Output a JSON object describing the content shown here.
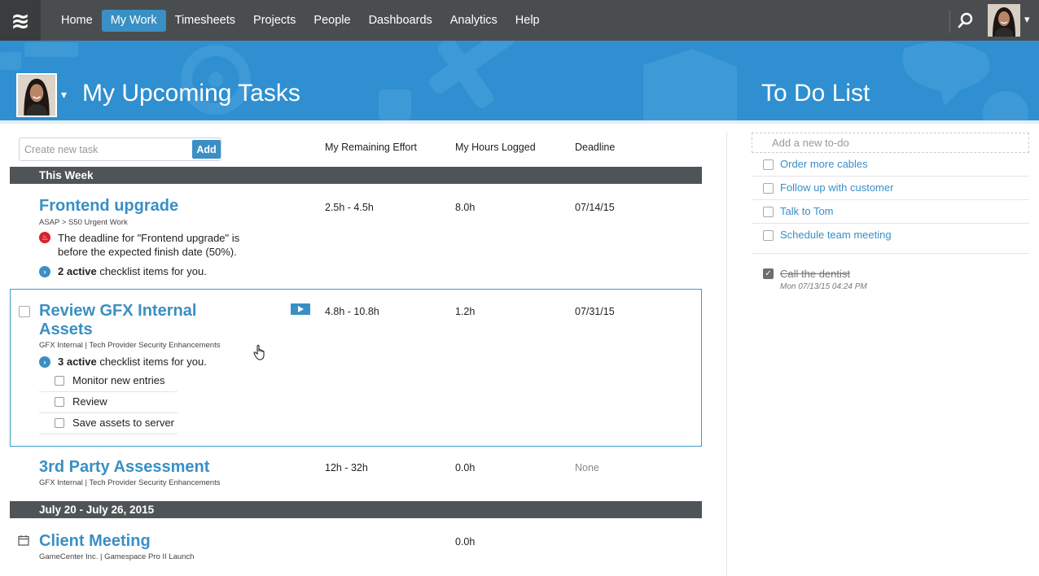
{
  "nav": {
    "logo_glyph": "≋",
    "items": [
      "Home",
      "My Work",
      "Timesheets",
      "Projects",
      "People",
      "Dashboards",
      "Analytics",
      "Help"
    ],
    "active": "My Work",
    "caret": "▾"
  },
  "banner": {
    "title": "My Upcoming Tasks",
    "todo_title": "To Do List",
    "caret": "▾"
  },
  "create_task": {
    "placeholder": "Create new task",
    "add_label": "Add"
  },
  "columns": {
    "remaining": "My Remaining Effort",
    "logged": "My Hours Logged",
    "deadline": "Deadline"
  },
  "sections": {
    "this_week": "This Week",
    "next_week": "July 20 - July 26, 2015"
  },
  "tasks": {
    "frontend": {
      "title": "Frontend upgrade",
      "breadcrumb": "ASAP  >  S50 Urgent Work",
      "warning": "The deadline for \"Frontend upgrade\" is before the expected finish date (50%).",
      "checklist_count": "2 active",
      "checklist_suffix": " checklist items for you.",
      "remaining": "2.5h - 4.5h",
      "logged": "8.0h",
      "deadline": "07/14/15"
    },
    "gfx": {
      "title": "Review GFX Internal Assets",
      "breadcrumb": "GFX Internal  |  Tech Provider Security Enhancements",
      "checklist_count": "3 active",
      "checklist_suffix": " checklist items for you.",
      "subitems": [
        "Monitor new entries",
        "Review",
        "Save assets to server"
      ],
      "remaining": "4.8h - 10.8h",
      "logged": "1.2h",
      "deadline": "07/31/15"
    },
    "thirdparty": {
      "title": "3rd Party Assessment",
      "breadcrumb": "GFX Internal  |  Tech Provider Security Enhancements",
      "remaining": "12h - 32h",
      "logged": "0.0h",
      "deadline": "None"
    },
    "client": {
      "title": "Client Meeting",
      "breadcrumb": "GameCenter Inc.  |  Gamespace Pro II Launch",
      "logged": "0.0h"
    }
  },
  "todo": {
    "placeholder": "Add a new to-do",
    "items": [
      "Order more cables",
      "Follow up with customer",
      "Talk to Tom",
      "Schedule team meeting"
    ],
    "done": {
      "label": "Call the dentist",
      "time": "Mon 07/13/15 04:24 PM"
    }
  },
  "icons": {
    "warning": "flame-icon",
    "chevron": "chevron-right-icon",
    "checkmark": "✓"
  },
  "colors": {
    "accent": "#3a8fc4",
    "nav_bg": "#4a4d50",
    "banner_bg": "#2f8fd0",
    "section_bg": "#4f5457",
    "warning": "#d92128"
  }
}
